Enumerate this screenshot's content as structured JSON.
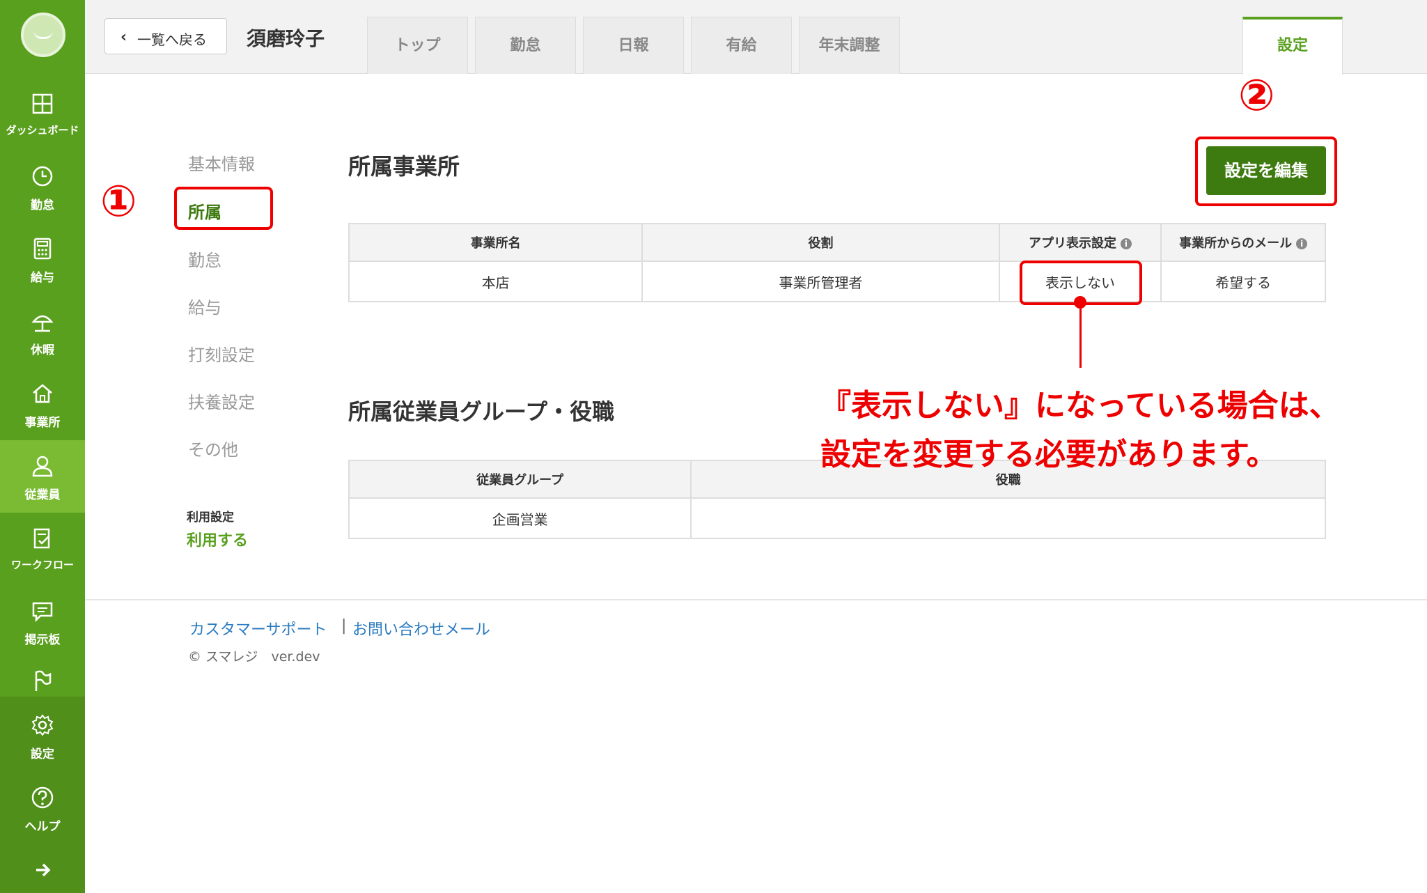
{
  "sidebar": {
    "items": [
      {
        "label": "ダッシュボード",
        "icon": "dashboard-icon"
      },
      {
        "label": "勤怠",
        "icon": "clock-icon"
      },
      {
        "label": "給与",
        "icon": "calculator-icon"
      },
      {
        "label": "休暇",
        "icon": "umbrella-icon"
      },
      {
        "label": "事業所",
        "icon": "home-icon"
      },
      {
        "label": "従業員",
        "icon": "user-icon"
      },
      {
        "label": "ワークフロー",
        "icon": "workflow-icon"
      },
      {
        "label": "掲示板",
        "icon": "chat-icon"
      },
      {
        "label": "",
        "icon": "flag-icon"
      },
      {
        "label": "設定",
        "icon": "gear-icon"
      },
      {
        "label": "ヘルプ",
        "icon": "help-icon"
      }
    ],
    "active": "従業員"
  },
  "header": {
    "back_label": "一覧へ戻る",
    "employee_name": "須磨玲子",
    "tabs": [
      "トップ",
      "勤怠",
      "日報",
      "有給",
      "年末調整"
    ],
    "settings_tab": "設定"
  },
  "subnav": {
    "items": [
      "基本情報",
      "所属",
      "勤怠",
      "給与",
      "打刻設定",
      "扶養設定",
      "その他"
    ],
    "active": "所属",
    "use_label": "利用設定",
    "use_value": "利用する"
  },
  "office_section": {
    "title": "所属事業所",
    "edit_button": "設定を編集",
    "headers": [
      "事業所名",
      "役割",
      "アプリ表示設定",
      "事業所からのメール"
    ],
    "row": [
      "本店",
      "事業所管理者",
      "表示しない",
      "希望する"
    ]
  },
  "group_section": {
    "title": "所属従業員グループ・役職",
    "headers": [
      "従業員グループ",
      "役職"
    ],
    "row": [
      "企画営業",
      ""
    ]
  },
  "annotations": {
    "step1": "①",
    "step2": "②",
    "note_line1": "『表示しない』になっている場合は、",
    "note_line2": "設定を変更する必要があります。",
    "color": "#e00000"
  },
  "footer": {
    "support_link": "カスタマーサポート",
    "separator": "|",
    "mail_link": "お問い合わせメール",
    "copyright": "© スマレジ　ver.dev"
  },
  "colors": {
    "brand_green": "#5aa01f",
    "dark_green": "#3d7a10",
    "link_blue": "#2b7bc0"
  }
}
